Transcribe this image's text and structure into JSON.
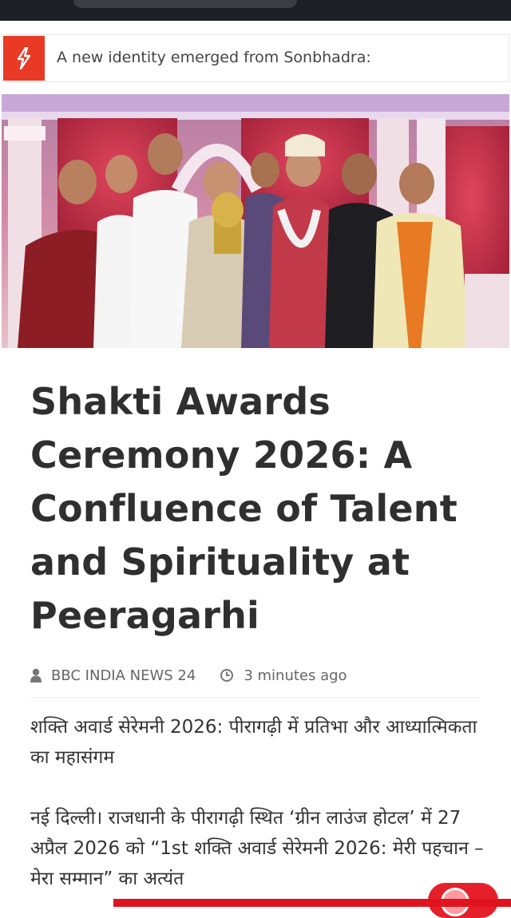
{
  "ticker": {
    "icon": "lightning-icon",
    "text": "A new identity emerged from Sonbhadra:"
  },
  "hero": {
    "alt": "photo"
  },
  "article": {
    "headline": "Shakti Awards Ceremony 2026: A Confluence of Talent and Spirituality at Peeragarhi",
    "author": "BBC INDIA NEWS 24",
    "time": "3 minutes ago",
    "subtitle": "शक्ति अवार्ड सेरेमनी 2026: पीरागढ़ी में प्रतिभा और आध्यात्मिकता का महासंगम",
    "body": "नई दिल्ली। राजधानी के पीरागढ़ी स्थित ‘ग्रीन लाउंज होटल’ में 27 अप्रैल 2026 को “1st शक्ति अवार्ड सेरेमनी 2026: मेरी पहचान – मेरा सम्मान” का अत्यंत"
  },
  "colors": {
    "accent": "#e83a25",
    "headline": "#2f2f2f",
    "fab": "#e6202a"
  }
}
